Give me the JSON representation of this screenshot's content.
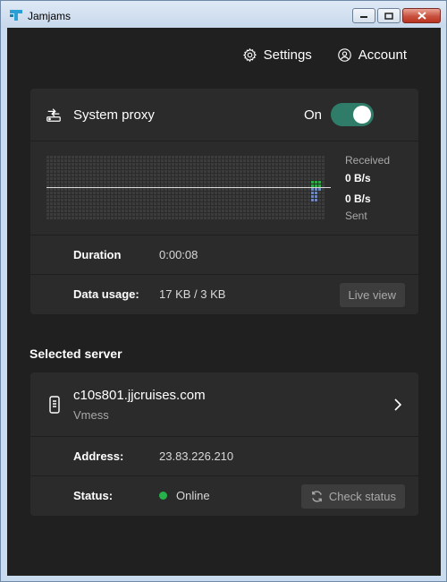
{
  "window": {
    "title": "Jamjams"
  },
  "nav": {
    "settings_label": "Settings",
    "account_label": "Account"
  },
  "proxy": {
    "label": "System proxy",
    "state": "On",
    "enabled": true,
    "received_label": "Received",
    "received_value": "0 B/s",
    "sent_value": "0 B/s",
    "sent_label": "Sent",
    "duration_label": "Duration",
    "duration_value": "0:00:08",
    "usage_label": "Data usage:",
    "usage_value": "17 KB / 3 KB",
    "live_view_label": "Live view"
  },
  "server_section": {
    "title": "Selected server"
  },
  "server": {
    "name": "c10s801.jjcruises.com",
    "type": "Vmess",
    "address_label": "Address:",
    "address_value": "23.83.226.210",
    "status_label": "Status:",
    "status_value": "Online",
    "check_status_label": "Check status"
  },
  "colors": {
    "background": "#202020",
    "card": "#2b2b2b",
    "toggle_on": "#2f7d69",
    "received_bars": "#2fa84a",
    "sent_bars": "#6f86b8",
    "status_online": "#27b14b"
  }
}
